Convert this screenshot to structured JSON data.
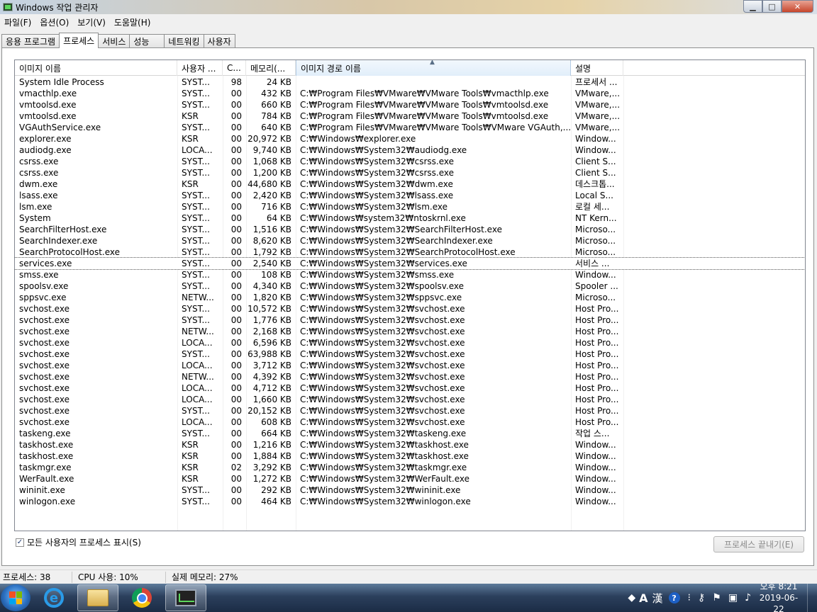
{
  "window": {
    "title": "Windows 작업 관리자"
  },
  "menu": [
    "파일(F)",
    "옵션(O)",
    "보기(V)",
    "도움말(H)"
  ],
  "tabs": [
    "응용 프로그램",
    "프로세스",
    "서비스",
    "성능",
    "네트워킹",
    "사용자"
  ],
  "columns": [
    "이미지 이름",
    "사용자 ...",
    "C...",
    "메모리(...",
    "이미지 경로 이름",
    "설명"
  ],
  "rows": [
    [
      "System Idle Process",
      "SYST...",
      "98",
      "24 KB",
      "",
      "프로세서 ..."
    ],
    [
      "vmacthlp.exe",
      "SYST...",
      "00",
      "432 KB",
      "C:₩Program Files₩VMware₩VMware Tools₩vmacthlp.exe",
      "VMware,..."
    ],
    [
      "vmtoolsd.exe",
      "SYST...",
      "00",
      "660 KB",
      "C:₩Program Files₩VMware₩VMware Tools₩vmtoolsd.exe",
      "VMware,..."
    ],
    [
      "vmtoolsd.exe",
      "KSR",
      "00",
      "784 KB",
      "C:₩Program Files₩VMware₩VMware Tools₩vmtoolsd.exe",
      "VMware,..."
    ],
    [
      "VGAuthService.exe",
      "SYST...",
      "00",
      "640 KB",
      "C:₩Program Files₩VMware₩VMware Tools₩VMware VGAuth,...",
      "VMware,..."
    ],
    [
      "explorer.exe",
      "KSR",
      "00",
      "20,972 KB",
      "C:₩Windows₩explorer.exe",
      "Window..."
    ],
    [
      "audiodg.exe",
      "LOCA...",
      "00",
      "9,740 KB",
      "C:₩Windows₩System32₩audiodg.exe",
      "Window..."
    ],
    [
      "csrss.exe",
      "SYST...",
      "00",
      "1,068 KB",
      "C:₩Windows₩System32₩csrss.exe",
      "Client S..."
    ],
    [
      "csrss.exe",
      "SYST...",
      "00",
      "1,200 KB",
      "C:₩Windows₩System32₩csrss.exe",
      "Client S..."
    ],
    [
      "dwm.exe",
      "KSR",
      "00",
      "44,680 KB",
      "C:₩Windows₩System32₩dwm.exe",
      "데스크톱..."
    ],
    [
      "lsass.exe",
      "SYST...",
      "00",
      "2,420 KB",
      "C:₩Windows₩System32₩lsass.exe",
      "Local S..."
    ],
    [
      "lsm.exe",
      "SYST...",
      "00",
      "716 KB",
      "C:₩Windows₩System32₩lsm.exe",
      "로컬 세..."
    ],
    [
      "System",
      "SYST...",
      "00",
      "64 KB",
      "C:₩Windows₩system32₩ntoskrnl.exe",
      "NT Kern..."
    ],
    [
      "SearchFilterHost.exe",
      "SYST...",
      "00",
      "1,516 KB",
      "C:₩Windows₩System32₩SearchFilterHost.exe",
      "Microso..."
    ],
    [
      "SearchIndexer.exe",
      "SYST...",
      "00",
      "8,620 KB",
      "C:₩Windows₩System32₩SearchIndexer.exe",
      "Microso..."
    ],
    [
      "SearchProtocolHost.exe",
      "SYST...",
      "00",
      "1,792 KB",
      "C:₩Windows₩System32₩SearchProtocolHost.exe",
      "Microso..."
    ],
    [
      "services.exe",
      "SYST...",
      "00",
      "2,540 KB",
      "C:₩Windows₩System32₩services.exe",
      "서비스 ..."
    ],
    [
      "smss.exe",
      "SYST...",
      "00",
      "108 KB",
      "C:₩Windows₩System32₩smss.exe",
      "Window..."
    ],
    [
      "spoolsv.exe",
      "SYST...",
      "00",
      "4,340 KB",
      "C:₩Windows₩System32₩spoolsv.exe",
      "Spooler ..."
    ],
    [
      "sppsvc.exe",
      "NETW...",
      "00",
      "1,820 KB",
      "C:₩Windows₩System32₩sppsvc.exe",
      "Microso..."
    ],
    [
      "svchost.exe",
      "SYST...",
      "00",
      "10,572 KB",
      "C:₩Windows₩System32₩svchost.exe",
      "Host Pro..."
    ],
    [
      "svchost.exe",
      "SYST...",
      "00",
      "1,776 KB",
      "C:₩Windows₩System32₩svchost.exe",
      "Host Pro..."
    ],
    [
      "svchost.exe",
      "NETW...",
      "00",
      "2,168 KB",
      "C:₩Windows₩System32₩svchost.exe",
      "Host Pro..."
    ],
    [
      "svchost.exe",
      "LOCA...",
      "00",
      "6,596 KB",
      "C:₩Windows₩System32₩svchost.exe",
      "Host Pro..."
    ],
    [
      "svchost.exe",
      "SYST...",
      "00",
      "63,988 KB",
      "C:₩Windows₩System32₩svchost.exe",
      "Host Pro..."
    ],
    [
      "svchost.exe",
      "LOCA...",
      "00",
      "3,712 KB",
      "C:₩Windows₩System32₩svchost.exe",
      "Host Pro..."
    ],
    [
      "svchost.exe",
      "NETW...",
      "00",
      "4,392 KB",
      "C:₩Windows₩System32₩svchost.exe",
      "Host Pro..."
    ],
    [
      "svchost.exe",
      "LOCA...",
      "00",
      "4,712 KB",
      "C:₩Windows₩System32₩svchost.exe",
      "Host Pro..."
    ],
    [
      "svchost.exe",
      "LOCA...",
      "00",
      "1,660 KB",
      "C:₩Windows₩System32₩svchost.exe",
      "Host Pro..."
    ],
    [
      "svchost.exe",
      "SYST...",
      "00",
      "20,152 KB",
      "C:₩Windows₩System32₩svchost.exe",
      "Host Pro..."
    ],
    [
      "svchost.exe",
      "LOCA...",
      "00",
      "608 KB",
      "C:₩Windows₩System32₩svchost.exe",
      "Host Pro..."
    ],
    [
      "taskeng.exe",
      "SYST...",
      "00",
      "664 KB",
      "C:₩Windows₩System32₩taskeng.exe",
      "작업 스..."
    ],
    [
      "taskhost.exe",
      "KSR",
      "00",
      "1,216 KB",
      "C:₩Windows₩System32₩taskhost.exe",
      "Window..."
    ],
    [
      "taskhost.exe",
      "KSR",
      "00",
      "1,884 KB",
      "C:₩Windows₩System32₩taskhost.exe",
      "Window..."
    ],
    [
      "taskmgr.exe",
      "KSR",
      "02",
      "3,292 KB",
      "C:₩Windows₩System32₩taskmgr.exe",
      "Window..."
    ],
    [
      "WerFault.exe",
      "KSR",
      "00",
      "1,272 KB",
      "C:₩Windows₩System32₩WerFault.exe",
      "Window..."
    ],
    [
      "wininit.exe",
      "SYST...",
      "00",
      "292 KB",
      "C:₩Windows₩System32₩wininit.exe",
      "Window..."
    ],
    [
      "winlogon.exe",
      "SYST...",
      "00",
      "464 KB",
      "C:₩Windows₩System32₩winlogon.exe",
      "Window..."
    ]
  ],
  "selected_row": 16,
  "show_all_users": {
    "label": "모든 사용자의 프로세스 표시(S)",
    "checked": true,
    "mark": "✓"
  },
  "end_process_button": "프로세스 끝내기(E)",
  "status": {
    "processes": "프로세스: 38",
    "cpu": "CPU 사용: 10%",
    "memory": "실제 메모리: 27%"
  },
  "taskbar": {
    "apps": [
      "start-icon",
      "internet-explorer-icon",
      "file-explorer-icon",
      "chrome-icon",
      "task-manager-icon"
    ],
    "lang_a": "A",
    "lang_han": "漢",
    "help": "?",
    "clock_time": "오후 8:21",
    "clock_date": "2019-06-22"
  }
}
